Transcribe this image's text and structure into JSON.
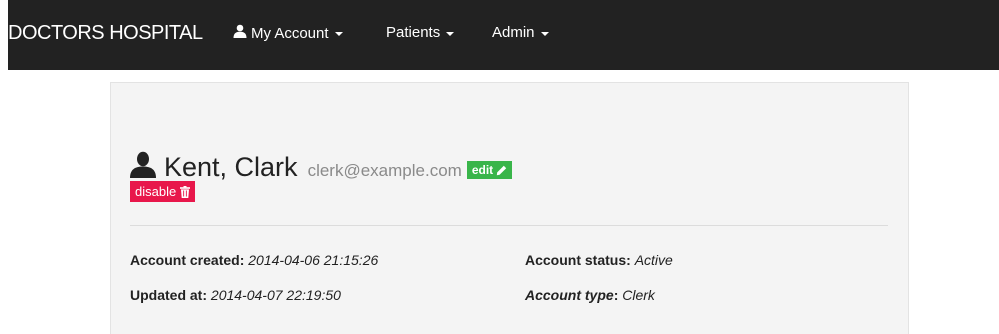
{
  "navbar": {
    "brand": "DOCTORS HOSPITAL",
    "items": [
      {
        "label": "My Account",
        "icon": "user-icon"
      },
      {
        "label": "Patients"
      },
      {
        "label": "Admin"
      }
    ],
    "background": "#222222"
  },
  "profile": {
    "name": "Kent, Clark",
    "email": "clerk@example.com",
    "edit_label": "edit",
    "edit_icon": "pencil-icon",
    "disable_label": "disable",
    "disable_icon": "trash-icon",
    "colors": {
      "edit": "#39b54a",
      "disable": "#e8174b"
    }
  },
  "details": {
    "created_label": "Account created",
    "created_value": "2014-04-06 21:15:26",
    "updated_label": "Updated at",
    "updated_value": "2014-04-07 22:19:50",
    "status_label": "Account status",
    "status_value": "Active",
    "type_label": "Account type",
    "type_value": "Clerk"
  }
}
